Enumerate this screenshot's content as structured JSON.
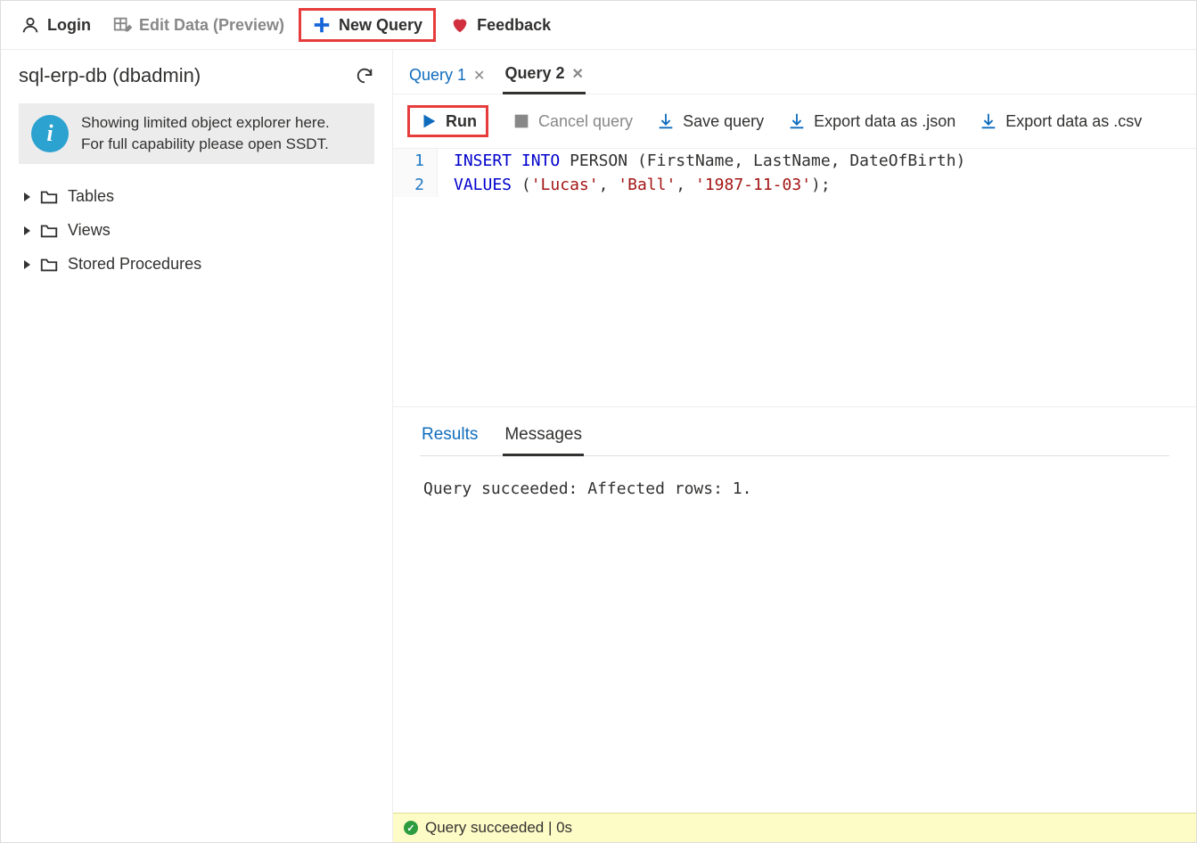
{
  "toolbar": {
    "login": "Login",
    "edit_data": "Edit Data (Preview)",
    "new_query": "New Query",
    "feedback": "Feedback"
  },
  "sidebar": {
    "db_title": "sql-erp-db (dbadmin)",
    "info_line1": "Showing limited object explorer here.",
    "info_line2": "For full capability please open SSDT.",
    "tree": {
      "tables": "Tables",
      "views": "Views",
      "sprocs": "Stored Procedures"
    }
  },
  "tabs": {
    "q1": "Query 1",
    "q2": "Query 2"
  },
  "query_toolbar": {
    "run": "Run",
    "cancel": "Cancel query",
    "save": "Save query",
    "export_json": "Export data as .json",
    "export_csv": "Export data as .csv"
  },
  "editor": {
    "line1_num": "1",
    "line2_num": "2"
  },
  "sql_tokens": {
    "insert_into": "INSERT INTO",
    "table": "PERSON",
    "cols": "(FirstName, LastName, DateOfBirth)",
    "values_kw": "VALUES",
    "open": "(",
    "s1": "'Lucas'",
    "c1": ", ",
    "s2": "'Ball'",
    "c2": ", ",
    "s3": "'1987-11-03'",
    "close": ");"
  },
  "results": {
    "tab_results": "Results",
    "tab_messages": "Messages",
    "message": "Query succeeded: Affected rows: 1."
  },
  "status": {
    "text": "Query succeeded | 0s"
  }
}
